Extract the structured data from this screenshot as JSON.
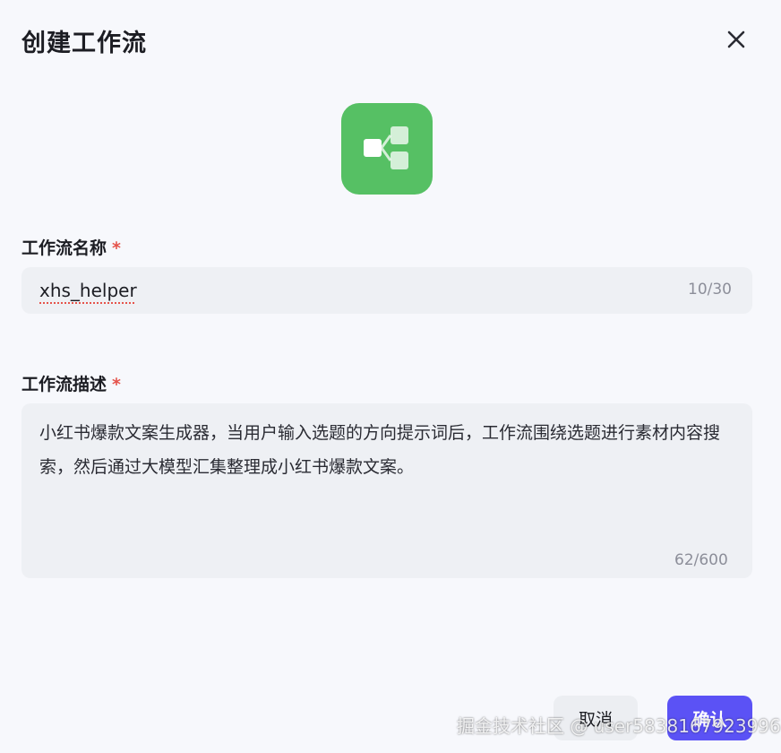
{
  "dialog": {
    "title": "创建工作流",
    "close_icon": "close-icon",
    "app_icon": {
      "name": "workflow-icon",
      "color": "#56c064"
    }
  },
  "name_field": {
    "label": "工作流名称",
    "required_mark": "*",
    "value": "xhs_helper",
    "counter": "10/30"
  },
  "desc_field": {
    "label": "工作流描述",
    "required_mark": "*",
    "value": "小红书爆款文案生成器，当用户输入选题的方向提示词后，工作流围绕选题进行素材内容搜索，然后通过大模型汇集整理成小红书爆款文案。",
    "counter": "62/600"
  },
  "footer": {
    "cancel_label": "取消",
    "confirm_label": "确认",
    "confirm_color": "#5b52f5"
  },
  "watermark": "掘金技术社区 @ user5838167923996"
}
